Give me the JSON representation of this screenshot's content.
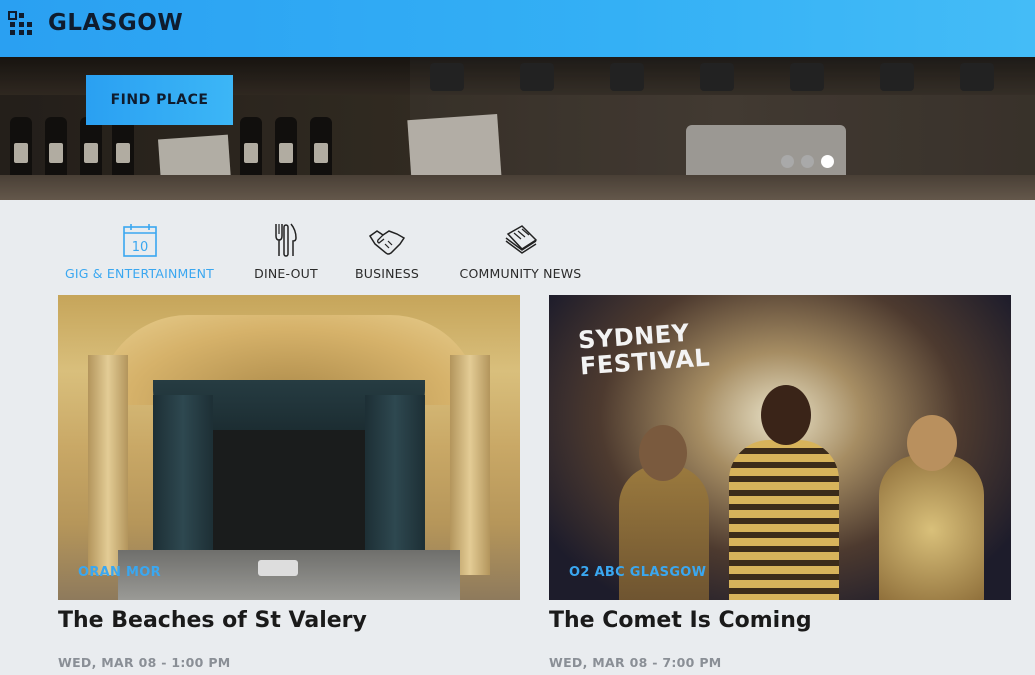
{
  "header": {
    "logo": "GLASGOW",
    "menu_icon": "grid-menu-icon",
    "brand_color": "#2aa0f2"
  },
  "hero": {
    "button_label": "FIND PLACE",
    "slides": 3,
    "active_slide": 3
  },
  "categories": [
    {
      "label": "GIG & ENTERTAINMENT",
      "icon": "calendar-icon",
      "icon_text": "10",
      "active": true
    },
    {
      "label": "DINE-OUT",
      "icon": "cutlery-icon",
      "active": false
    },
    {
      "label": "BUSINESS",
      "icon": "handshake-icon",
      "active": false
    },
    {
      "label": "COMMUNITY NEWS",
      "icon": "newspaper-icon",
      "active": false
    }
  ],
  "events": [
    {
      "venue": "ORAN MOR",
      "title": "The Beaches of St Valery",
      "date": "WED, MAR 08 - 1:00 PM"
    },
    {
      "venue": "O2 ABC GLASGOW",
      "title": "The Comet Is Coming",
      "date": "WED, MAR 08 - 7:00 PM",
      "image_text": [
        "SYDNEY",
        "FESTIVAL"
      ]
    }
  ]
}
